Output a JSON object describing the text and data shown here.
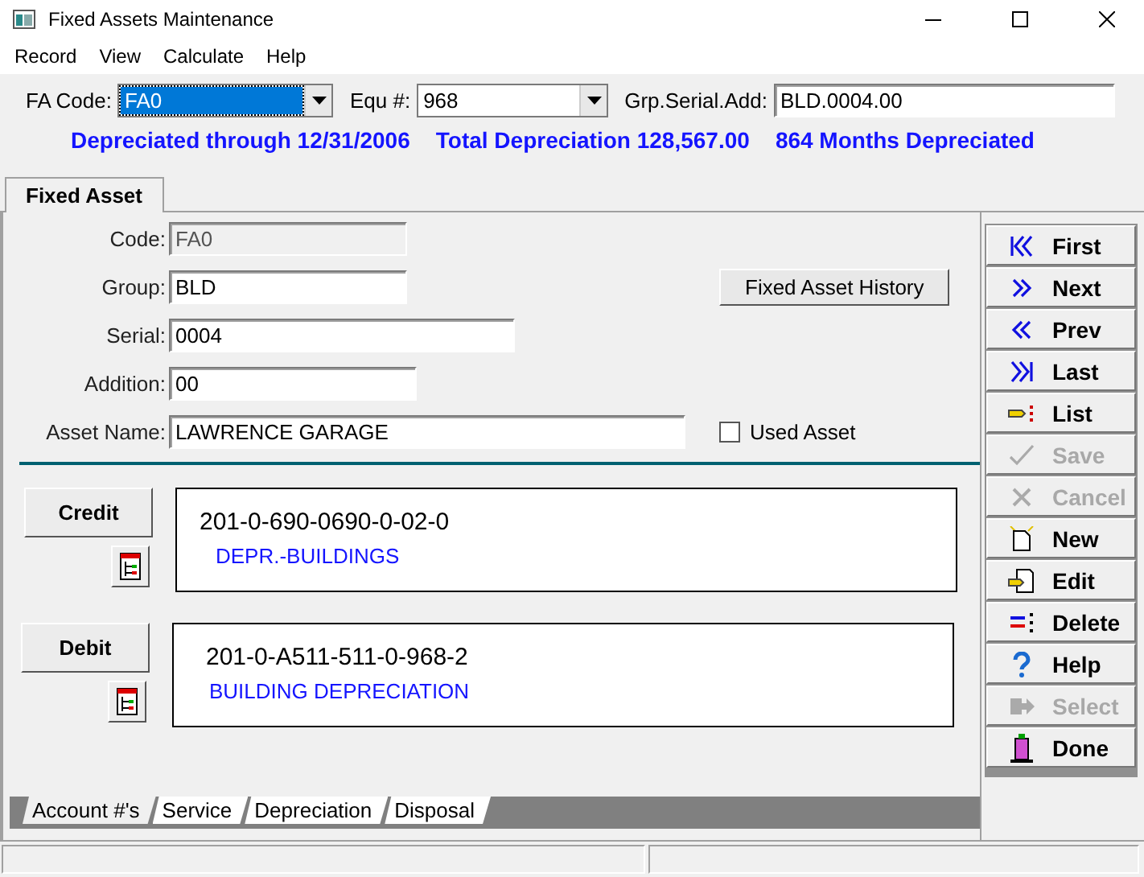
{
  "window": {
    "title": "Fixed Assets Maintenance"
  },
  "menu": [
    "Record",
    "View",
    "Calculate",
    "Help"
  ],
  "toolbar": {
    "fa_code": {
      "label": "FA Code:",
      "value": "FA0",
      "selected": true
    },
    "equ": {
      "label": "Equ #:",
      "value": "968"
    },
    "grp": {
      "label": "Grp.Serial.Add:",
      "value": "BLD.0004.00"
    }
  },
  "summary": [
    "Depreciated through 12/31/2006",
    "Total Depreciation 128,567.00",
    "864 Months Depreciated"
  ],
  "top_tab": {
    "label": "Fixed Asset",
    "selected": true
  },
  "fields": [
    {
      "label": "Code:",
      "value": "FA0",
      "disabled": true
    },
    {
      "label": "Group:",
      "value": "BLD",
      "disabled": false
    },
    {
      "label": "Serial:",
      "value": "0004",
      "disabled": false
    },
    {
      "label": "Addition:",
      "value": "00",
      "disabled": false
    },
    {
      "label": "Asset Name:",
      "value": "LAWRENCE GARAGE",
      "disabled": false
    }
  ],
  "history_button": "Fixed Asset History",
  "used_asset": {
    "label": "Used Asset",
    "checked": false
  },
  "accounts": [
    {
      "button": "Credit",
      "number": "201-0-690-0690-0-02-0",
      "description": "DEPR.-BUILDINGS"
    },
    {
      "button": "Debit",
      "number": "201-0-A511-511-0-968-2",
      "description": "BUILDING DEPRECIATION"
    }
  ],
  "nav_buttons": [
    {
      "label": "First",
      "disabled": false
    },
    {
      "label": "Next",
      "disabled": false
    },
    {
      "label": "Prev",
      "disabled": false
    },
    {
      "label": "Last",
      "disabled": false
    },
    {
      "label": "List",
      "disabled": false
    },
    {
      "label": "Save",
      "disabled": true
    },
    {
      "label": "Cancel",
      "disabled": true
    },
    {
      "label": "New",
      "disabled": false
    },
    {
      "label": "Edit",
      "disabled": false
    },
    {
      "label": "Delete",
      "disabled": false
    },
    {
      "label": "Help",
      "disabled": false
    },
    {
      "label": "Select",
      "disabled": true
    },
    {
      "label": "Done",
      "disabled": false
    }
  ],
  "bottom_tabs": [
    {
      "label": "Account #'s",
      "selected": true
    },
    {
      "label": "Service",
      "selected": false
    },
    {
      "label": "Depreciation",
      "selected": false
    },
    {
      "label": "Disposal",
      "selected": false
    }
  ]
}
